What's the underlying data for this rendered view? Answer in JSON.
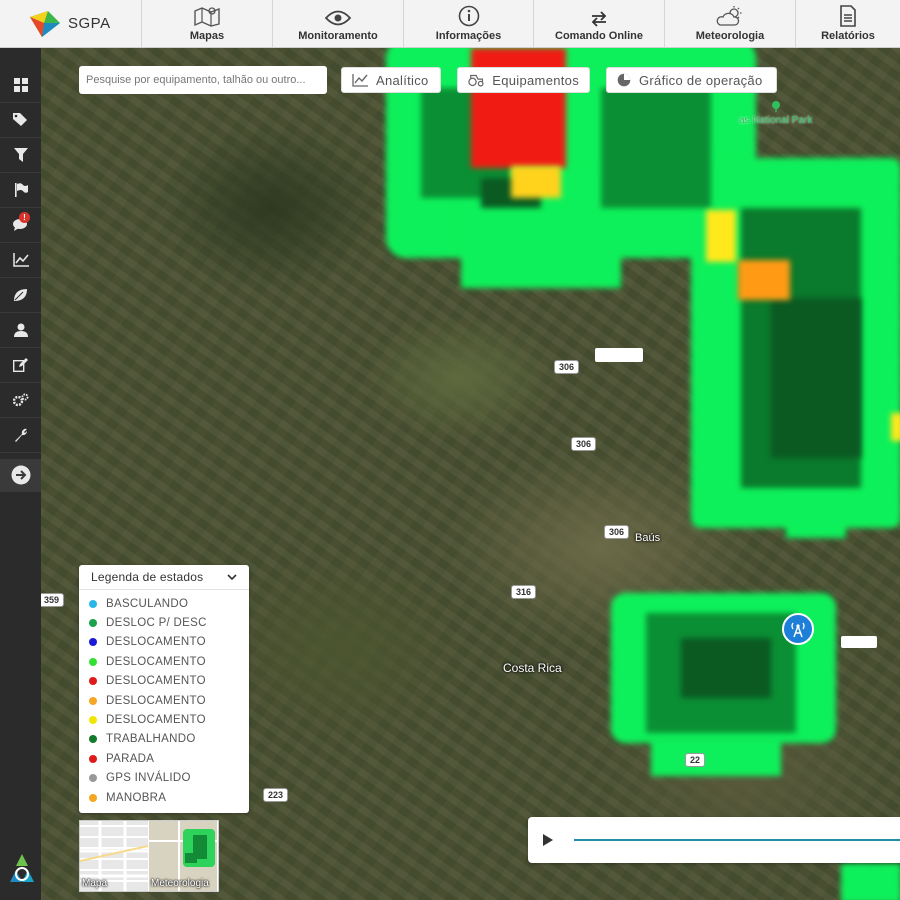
{
  "app": {
    "name": "SGPA"
  },
  "nav": [
    {
      "label": "Mapas",
      "icon": "map-icon"
    },
    {
      "label": "Monitoramento",
      "icon": "eye-icon"
    },
    {
      "label": "Informações",
      "icon": "info-icon"
    },
    {
      "label": "Comando Online",
      "icon": "swap-arrows-icon"
    },
    {
      "label": "Meteorologia",
      "icon": "weather-cloud-sun-icon"
    },
    {
      "label": "Relatórios",
      "icon": "report-document-icon"
    }
  ],
  "sidebar": {
    "items": [
      "dashboard-grid-icon",
      "tag-icon",
      "filter-icon",
      "flag-icon",
      "chat-icon",
      "line-chart-icon",
      "leaf-icon",
      "user-icon",
      "edit-icon",
      "cogs-icon",
      "wrench-icon"
    ],
    "chat_badge": "!",
    "expand_icon": "arrow-right-circle-icon"
  },
  "search": {
    "placeholder": "Pesquise por equipamento, talhão ou outro..."
  },
  "toolbar": {
    "analitico": "Analítico",
    "equipamentos": "Equipamentos",
    "grafico": "Gráfico de operação"
  },
  "legend": {
    "title": "Legenda de estados",
    "items": [
      {
        "label": "BASCULANDO",
        "color": "#29b6e8"
      },
      {
        "label": "DESLOC P/ DESC",
        "color": "#1aa34a"
      },
      {
        "label": "DESLOCAMENTO",
        "color": "#1a1adb"
      },
      {
        "label": "DESLOCAMENTO",
        "color": "#34e034"
      },
      {
        "label": "DESLOCAMENTO",
        "color": "#e01a1a"
      },
      {
        "label": "DESLOCAMENTO",
        "color": "#f5a623"
      },
      {
        "label": "DESLOCAMENTO",
        "color": "#f2e600"
      },
      {
        "label": "TRABALHANDO",
        "color": "#127a2a"
      },
      {
        "label": "PARADA",
        "color": "#e01a1a"
      },
      {
        "label": "GPS INVÁLIDO",
        "color": "#999999"
      },
      {
        "label": "MANOBRA",
        "color": "#f5a623"
      }
    ]
  },
  "thumbnails": {
    "map": "Mapa",
    "weather": "Meteorologia"
  },
  "map": {
    "places": {
      "costa_rica": "Costa Rica",
      "baus": "Baús",
      "park": "as National Park"
    },
    "roads": {
      "r306a": "306",
      "r306b": "306",
      "r306c": "306",
      "r316": "316",
      "r223": "223",
      "r22": "22",
      "r359": "359"
    }
  }
}
